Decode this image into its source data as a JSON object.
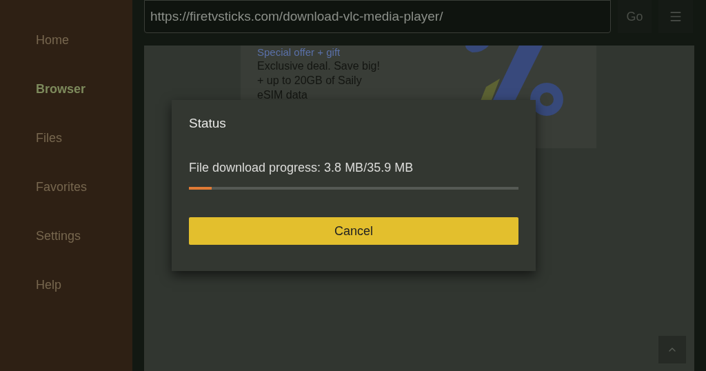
{
  "sidebar": {
    "items": [
      {
        "label": "Home",
        "selected": false
      },
      {
        "label": "Browser",
        "selected": true
      },
      {
        "label": "Files",
        "selected": false
      },
      {
        "label": "Favorites",
        "selected": false
      },
      {
        "label": "Settings",
        "selected": false
      },
      {
        "label": "Help",
        "selected": false
      }
    ]
  },
  "address_bar": {
    "value": "https://firetvsticks.com/download-vlc-media-player/",
    "go_button": "Go"
  },
  "page": {
    "ad": {
      "tagline": "Special offer + gift",
      "lines": [
        "Exclusive deal. Save big!",
        "+ up to 20GB of Saily",
        "eSIM data"
      ]
    }
  },
  "dialog": {
    "title": "Status",
    "message": "File download progress: 3.8 MB/35.9 MB",
    "progress": {
      "level": 0.07
    },
    "button": "Cancel"
  }
}
